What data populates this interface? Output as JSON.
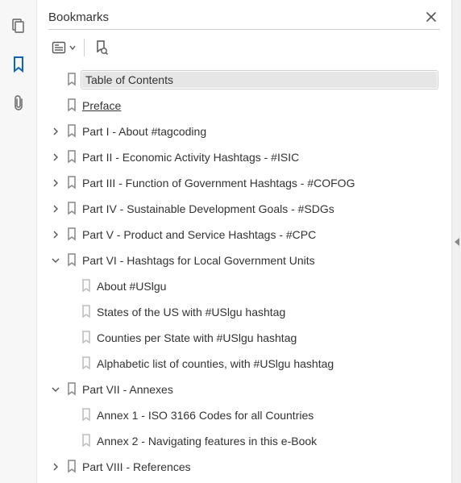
{
  "panel": {
    "title": "Bookmarks"
  },
  "bookmarks": {
    "toc": "Table of Contents",
    "preface": "Preface",
    "part1": "Part I - About #tagcoding",
    "part2": "Part II - Economic Activity Hashtags - #ISIC",
    "part3": "Part III - Function of Government Hashtags - #COFOG",
    "part4": "Part IV - Sustainable Development Goals - #SDGs",
    "part5": "Part V - Product and Service Hashtags - #CPC",
    "part6": "Part VI - Hashtags for Local Government Units",
    "part6_about": "About #USlgu",
    "part6_states": "States of the US with #USlgu hashtag",
    "part6_counties": "Counties per State with #USlgu hashtag",
    "part6_alpha": "Alphabetic list of counties, with #USlgu hashtag",
    "part7": "Part VII - Annexes",
    "part7_a1": "Annex 1 - ISO 3166 Codes for all Countries",
    "part7_a2": "Annex 2 - Navigating features in this e-Book",
    "part8": "Part VIII - References"
  }
}
